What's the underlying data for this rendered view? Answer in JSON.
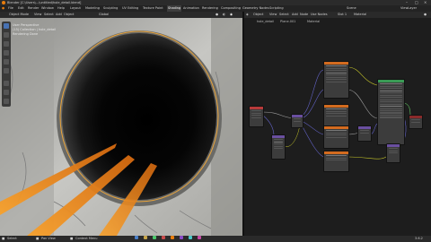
{
  "app": {
    "title": "Blender [C:\\Users\\...\\untitled\\hole_detail.blend]"
  },
  "menu": [
    "File",
    "Edit",
    "Render",
    "Window",
    "Help"
  ],
  "workspaces": [
    "Layout",
    "Modeling",
    "Sculpting",
    "UV Editing",
    "Texture Paint",
    "Shading",
    "Animation",
    "Rendering",
    "Compositing",
    "Geometry Nodes",
    "Scripting"
  ],
  "active_workspace": "Shading",
  "scene": "Scene",
  "view_layer": "ViewLayer",
  "viewport": {
    "mode": "Object Mode",
    "view": "View",
    "select": "Select",
    "add": "Add",
    "object": "Object",
    "transform": "Global",
    "overlay": [
      "User Perspective",
      "(15) Collection | hole_detail",
      "Rendering Done"
    ]
  },
  "node_editor": {
    "editor": "Object",
    "view": "View",
    "select": "Select",
    "add": "Add",
    "node": "Node",
    "use_nodes": "Use Nodes",
    "slot": "Slot 1",
    "material": "Material",
    "breadcrumb": [
      "hole_detail",
      "Plane.001",
      "Material"
    ]
  },
  "status": {
    "left": "Select",
    "mid": "Pan View",
    "right": "Context Menu",
    "version": "3.6.2"
  },
  "colors": {
    "orange": "#f28a1a",
    "selection": "#e8a33a",
    "header_input": "#b83a3a",
    "header_shader": "#3a9b55",
    "header_texture": "#d36b1f",
    "header_converter": "#2f6d8f",
    "header_vector": "#6a4fa0",
    "header_output": "#8a2a2a"
  }
}
